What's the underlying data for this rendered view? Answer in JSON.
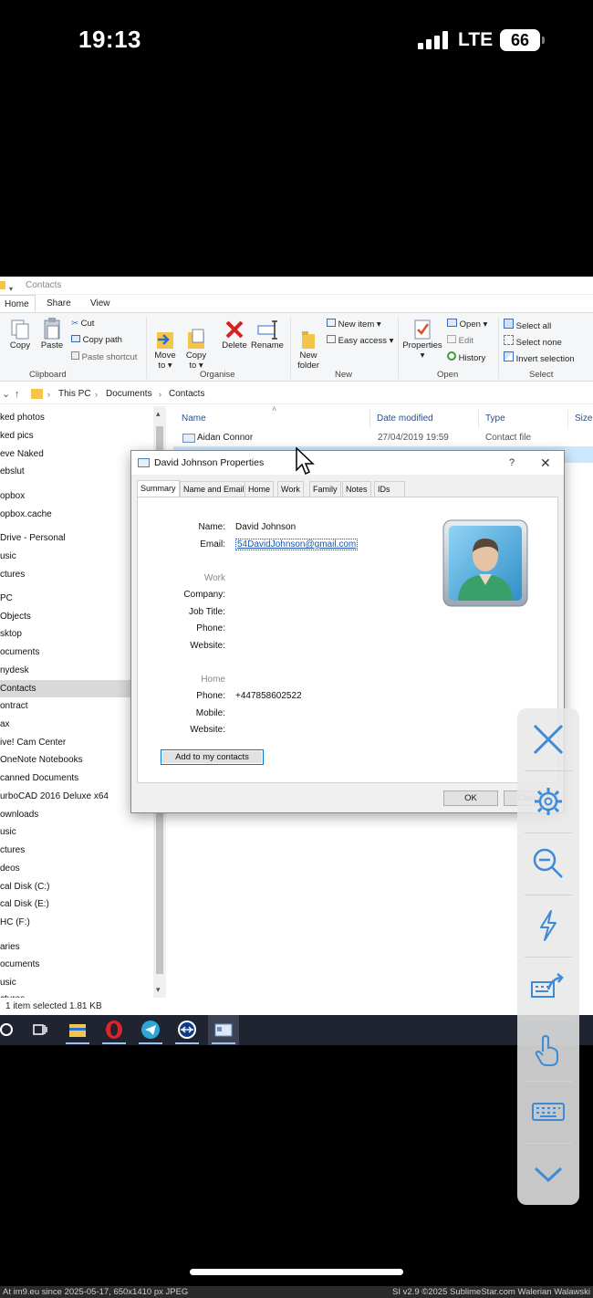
{
  "phone_status": {
    "time": "19:13",
    "network": "LTE",
    "battery": "66"
  },
  "explorer": {
    "window_title": "Contacts",
    "ribbon_tabs": [
      "Home",
      "Share",
      "View"
    ],
    "clipboard": {
      "copy": "Copy",
      "paste": "Paste",
      "cut": "Cut",
      "copy_path": "Copy path",
      "paste_shortcut": "Paste shortcut",
      "label": "Clipboard"
    },
    "organise": {
      "move_to": "Move\nto ▾",
      "copy_to": "Copy\nto ▾",
      "delete": "Delete",
      "rename": "Rename",
      "label": "Organise"
    },
    "new": {
      "new_folder": "New\nfolder",
      "new_item": "New item ▾",
      "easy_access": "Easy access ▾",
      "label": "New"
    },
    "open": {
      "properties": "Properties",
      "open": "Open ▾",
      "edit": "Edit",
      "history": "History",
      "label": "Open"
    },
    "select": {
      "select_all": "Select all",
      "select_none": "Select none",
      "invert": "Invert selection",
      "label": "Select"
    },
    "breadcrumb": [
      "This PC",
      "Documents",
      "Contacts"
    ],
    "nav_items": [
      "ked photos",
      "ked pics",
      "eve Naked",
      "ebslut",
      "opbox",
      "opbox.cache",
      "Drive - Personal",
      "usic",
      "ctures",
      " PC",
      " Objects",
      "sktop",
      "ocuments",
      "nydesk",
      "Contacts",
      "ontract",
      "ax",
      "ive! Cam Center",
      "OneNote Notebooks",
      "canned Documents",
      "urboCAD 2016 Deluxe x64",
      "ownloads",
      "usic",
      "ctures",
      "deos",
      "cal Disk (C:)",
      "cal Disk (E:)",
      "HC (F:)",
      "aries",
      "ocuments",
      "usic",
      "ctures"
    ],
    "columns": [
      "Name",
      "Date modified",
      "Type",
      "Size"
    ],
    "files": [
      {
        "name": "Aidan Connor",
        "date": "27/04/2019 19:59",
        "type": "Contact file"
      }
    ],
    "status": "1 item selected  1.81 KB"
  },
  "dialog": {
    "title": "David Johnson Properties",
    "help": "?",
    "close": "✕",
    "tabs": [
      "Summary",
      "Name and Email",
      "Home",
      "Work",
      "Family",
      "Notes",
      "IDs"
    ],
    "fields": {
      "name_label": "Name:",
      "name_value": "David Johnson",
      "email_label": "Email:",
      "email_value": "54DavidJohnson@gmail.com",
      "work_header": "Work",
      "company_label": "Company:",
      "jobtitle_label": "Job Title:",
      "work_phone_label": "Phone:",
      "work_website_label": "Website:",
      "home_header": "Home",
      "home_phone_label": "Phone:",
      "home_phone_value": "+447858602522",
      "mobile_label": "Mobile:",
      "home_website_label": "Website:"
    },
    "add_button": "Add to my contacts",
    "ok": "OK",
    "cancel": "Cancel"
  },
  "footer": {
    "left": "At im9.eu since 2025-05-17, 650x1410 px JPEG",
    "right": "SI v2.9 ©2025 SublimeStar.com Walerian Walawski"
  },
  "colors": {
    "accent": "#0078d7",
    "selection": "#cce8ff",
    "link": "#1a55b5",
    "taskbar": "#1f2430"
  },
  "icons": [
    "close-icon",
    "gear-icon",
    "zoom-out-icon",
    "lightning-icon",
    "keyboard-arrow-icon",
    "touch-icon",
    "keyboard-icon",
    "chevron-down-icon"
  ]
}
